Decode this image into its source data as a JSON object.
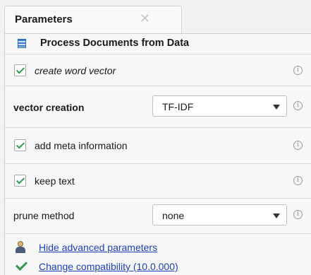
{
  "tab": {
    "label": "Parameters",
    "close_symbol": "✕"
  },
  "operator": {
    "title": "Process Documents from Data",
    "icon": "document-icon"
  },
  "params": {
    "create_word_vector": {
      "label": "create word vector",
      "checked": true
    },
    "vector_creation": {
      "label": "vector creation",
      "value": "TF-IDF"
    },
    "add_meta_information": {
      "label": "add meta information",
      "checked": true
    },
    "keep_text": {
      "label": "keep text",
      "checked": true
    },
    "prune_method": {
      "label": "prune method",
      "value": "none"
    }
  },
  "info_symbol": "i",
  "links": {
    "hide_advanced": "Hide advanced parameters",
    "change_compatibility": "Change compatibility (10.0.000)"
  },
  "colors": {
    "check": "#2f9a4c",
    "link": "#1a3fbf",
    "panel_bg": "#f7f7f7"
  }
}
